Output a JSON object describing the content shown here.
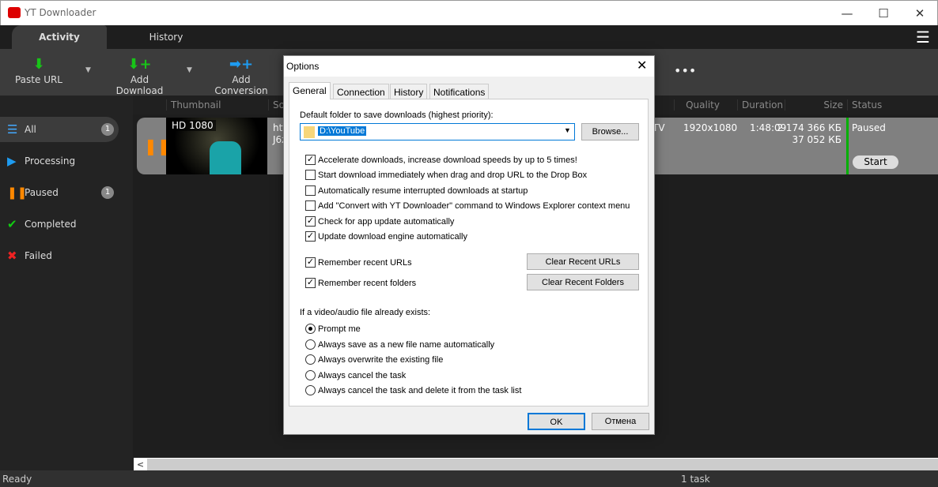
{
  "app": {
    "title": "YT Downloader",
    "accent": "#00b000"
  },
  "tabs": [
    {
      "label": "Activity",
      "active": true
    },
    {
      "label": "History",
      "active": false
    }
  ],
  "toolbar": {
    "paste_url": "Paste URL",
    "add_download": "Add Download",
    "add_conversion": "Add Conversion",
    "more": "•••"
  },
  "sidebar": {
    "items": [
      {
        "label": "All",
        "count": "1",
        "icon": "list-icon"
      },
      {
        "label": "Processing",
        "icon": "play-icon"
      },
      {
        "label": "Paused",
        "count": "1",
        "icon": "pause-icon"
      },
      {
        "label": "Completed",
        "icon": "check-icon"
      },
      {
        "label": "Failed",
        "icon": "x-icon"
      }
    ]
  },
  "columns": {
    "thumbnail": "Thumbnail",
    "source": "So",
    "quality": "Quality",
    "duration": "Duration",
    "size": "Size",
    "status": "Status"
  },
  "task": {
    "badge": "HD 1080",
    "source_line1": "htt",
    "source_line2": "J6z",
    "format_tail": "TV",
    "quality": "1920x1080",
    "duration": "1:48:09",
    "size_total": "2 174 366 КБ",
    "size_done": "37 052 КБ",
    "status": "Paused",
    "start_label": "Start"
  },
  "statusbar": {
    "left": "Ready",
    "center": "1 task"
  },
  "dialog": {
    "title": "Options",
    "tabs": [
      "General",
      "Connection",
      "History",
      "Notifications"
    ],
    "folder_label": "Default folder to save downloads (highest priority):",
    "folder_value": "D:\\YouTube",
    "browse": "Browse...",
    "checks": [
      {
        "label": "Accelerate downloads, increase download speeds by up to 5 times!",
        "checked": true
      },
      {
        "label": "Start download immediately when drag and drop URL to the Drop Box",
        "checked": false
      },
      {
        "label": "Automatically resume interrupted downloads at startup",
        "checked": false
      },
      {
        "label": "Add \"Convert with YT Downloader\" command to Windows Explorer context menu",
        "checked": false
      },
      {
        "label": "Check for app update automatically",
        "checked": true
      },
      {
        "label": "Update download engine automatically",
        "checked": true
      }
    ],
    "remember_urls": "Remember recent URLs",
    "remember_folders": "Remember recent folders",
    "clear_urls": "Clear Recent URLs",
    "clear_folders": "Clear Recent Folders",
    "exists_label": "If a video/audio file already exists:",
    "radios": [
      {
        "label": "Prompt me",
        "selected": true
      },
      {
        "label": "Always save as a new file name automatically",
        "selected": false
      },
      {
        "label": "Always overwrite the existing file",
        "selected": false
      },
      {
        "label": "Always cancel the task",
        "selected": false
      },
      {
        "label": "Always cancel the task and delete it from the task list",
        "selected": false
      }
    ],
    "ok": "OK",
    "cancel": "Отмена"
  }
}
